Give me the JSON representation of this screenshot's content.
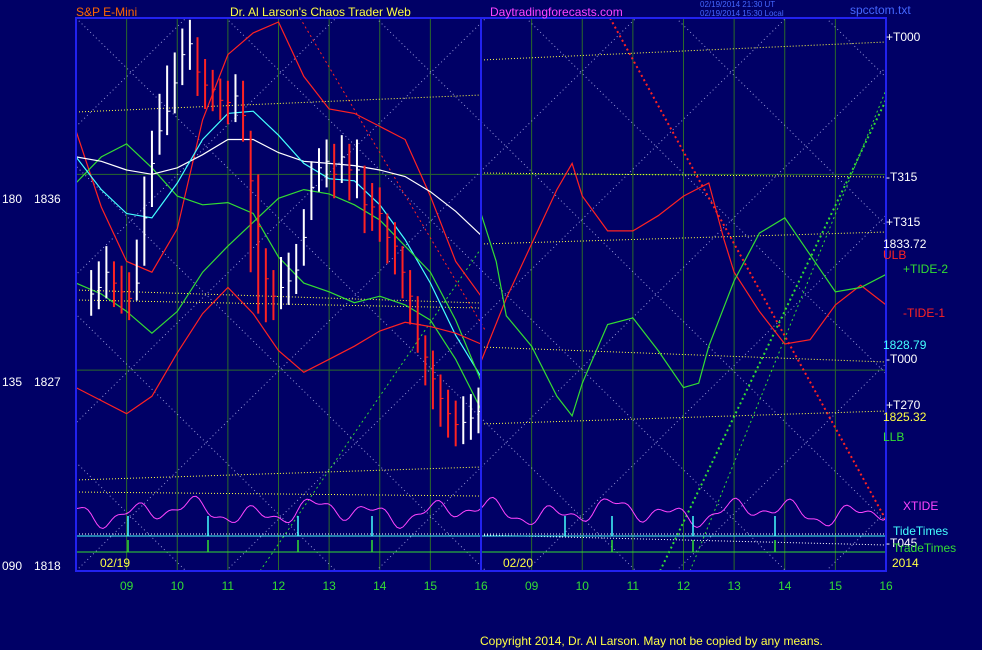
{
  "header": {
    "instrument": "S&P E-Mini",
    "site_title": "Dr. Al Larson's Chaos Trader Web",
    "site_url": "Daytradingforecasts.com",
    "timestamp_line1": "02/19/2014 21:30 UT",
    "timestamp_line2": "02/19/2014 15:30 Local",
    "file_name": "spcctom.txt"
  },
  "footer": {
    "copyright": "Copyright 2014, Dr. Al Larson. May not be copied by any means."
  },
  "colors": {
    "background": "#000066",
    "frame": "#2222ee",
    "grid": "#2a6a2a",
    "price_bar_up": "#ffffff",
    "price_bar_down": "#ff2222",
    "orange_text": "#ff6600",
    "magenta_text": "#ff44ff",
    "yellow_text": "#ffff44",
    "cyan": "#44ffff",
    "green": "#33dd33",
    "red": "#ff2222",
    "white": "#ffffff",
    "yellow": "#ffff44"
  },
  "chart_data": {
    "type": "line",
    "y_axis": {
      "left_labels": [
        {
          "price": 1836,
          "angle": "180"
        },
        {
          "price": 1827,
          "angle": "135"
        },
        {
          "price": 1818,
          "angle": "090"
        }
      ],
      "ylim": [
        1818,
        1843
      ]
    },
    "x_axis": {
      "day1_label": "02/19",
      "day2_label": "02/20",
      "year_label": "2014",
      "day1_hours": [
        "09",
        "10",
        "11",
        "12",
        "13",
        "14",
        "15",
        "16"
      ],
      "day2_hours": [
        "09",
        "10",
        "11",
        "12",
        "13",
        "14",
        "15",
        "16"
      ]
    },
    "price_levels": [
      {
        "label": "1833.72",
        "value": 1833.72
      },
      {
        "label": "1828.79",
        "value": 1828.79
      },
      {
        "label": "1825.32",
        "value": 1825.32
      }
    ],
    "right_labels": [
      {
        "text": "+T000",
        "color": "#ffffff"
      },
      {
        "text": "-T315",
        "color": "#ffffff"
      },
      {
        "text": "+T315",
        "color": "#ffffff"
      },
      {
        "text": "1833.72",
        "color": "#ffffff"
      },
      {
        "text": "ULB",
        "color": "#ff2222"
      },
      {
        "text": "+TIDE-2",
        "color": "#33dd33"
      },
      {
        "text": "-TIDE-1",
        "color": "#ff2222"
      },
      {
        "text": "1828.79",
        "color": "#44ffff"
      },
      {
        "text": "-T000",
        "color": "#ffffff"
      },
      {
        "text": "+T270",
        "color": "#ffffff"
      },
      {
        "text": "1825.32",
        "color": "#ffff44"
      },
      {
        "text": "LLB",
        "color": "#33dd33"
      },
      {
        "text": "XTIDE",
        "color": "#ff44ff"
      },
      {
        "text": "TideTimes",
        "color": "#44ffff"
      },
      {
        "text": "-T045",
        "color": "#ffffff"
      },
      {
        "text": "TradeTimes",
        "color": "#33dd33"
      }
    ],
    "series": [
      {
        "name": "S&P E-Mini",
        "kind": "bars",
        "day": 1,
        "t": [
          8.3,
          8.45,
          8.6,
          8.75,
          8.9,
          9.05,
          9.2,
          9.35,
          9.5,
          9.65,
          9.8,
          9.95,
          10.1,
          10.25,
          10.4,
          10.55,
          10.7,
          10.85,
          11.0,
          11.15,
          11.3,
          11.45,
          11.6,
          11.75,
          11.9,
          12.05,
          12.2,
          12.35,
          12.5,
          12.65,
          12.8,
          12.95,
          13.1,
          13.25,
          13.4,
          13.55,
          13.7,
          13.85,
          14.0,
          14.15,
          14.3,
          14.45,
          14.6,
          14.75,
          14.9,
          15.05,
          15.2,
          15.35,
          15.5,
          15.65,
          15.8,
          15.95
        ],
        "close": [
          1830.5,
          1830.8,
          1831.5,
          1831.0,
          1830.6,
          1830.3,
          1831.0,
          1834.0,
          1836.5,
          1838.0,
          1838.9,
          1840.2,
          1841.5,
          1842.0,
          1840.7,
          1840.1,
          1839.9,
          1839.4,
          1839.3,
          1839.6,
          1838.7,
          1835.7,
          1833.6,
          1831.2,
          1830.4,
          1830.8,
          1831.1,
          1831.6,
          1833.1,
          1835.4,
          1836.3,
          1836.6,
          1836.0,
          1836.8,
          1836.2,
          1836.2,
          1834.6,
          1834.5,
          1834.2,
          1833.1,
          1832.7,
          1831.5,
          1830.4,
          1829.1,
          1827.6,
          1826.6,
          1825.7,
          1825.0,
          1824.5,
          1824.6,
          1824.8,
          1825.1
        ],
        "high": [
          1831.6,
          1832.0,
          1832.7,
          1832.0,
          1831.8,
          1831.5,
          1833.0,
          1835.9,
          1838.0,
          1839.7,
          1841.0,
          1841.6,
          1842.7,
          1843.1,
          1842.3,
          1841.3,
          1840.8,
          1840.4,
          1840.3,
          1840.6,
          1840.3,
          1838.0,
          1836.0,
          1832.6,
          1831.6,
          1832.2,
          1832.4,
          1832.8,
          1834.4,
          1836.6,
          1837.2,
          1837.6,
          1837.4,
          1837.8,
          1837.4,
          1837.6,
          1836.4,
          1835.6,
          1835.4,
          1834.2,
          1833.8,
          1832.7,
          1831.6,
          1830.4,
          1828.6,
          1827.9,
          1826.8,
          1826.1,
          1825.6,
          1825.8,
          1825.9,
          1826.2
        ],
        "low": [
          1829.5,
          1829.8,
          1830.3,
          1829.9,
          1829.6,
          1829.3,
          1830.2,
          1831.8,
          1834.5,
          1836.9,
          1837.8,
          1838.8,
          1840.1,
          1840.8,
          1839.6,
          1839.0,
          1838.9,
          1838.5,
          1838.3,
          1838.4,
          1837.5,
          1831.5,
          1829.6,
          1829.2,
          1829.3,
          1829.8,
          1830.0,
          1830.5,
          1831.8,
          1833.9,
          1835.2,
          1835.4,
          1834.9,
          1835.6,
          1834.8,
          1834.9,
          1833.3,
          1833.4,
          1832.9,
          1831.9,
          1831.4,
          1830.3,
          1829.1,
          1827.8,
          1826.3,
          1825.2,
          1824.4,
          1823.9,
          1823.5,
          1823.6,
          1823.8,
          1824.1
        ]
      },
      {
        "name": "ULB",
        "color": "#ff2222",
        "day": 1,
        "t": [
          8.0,
          8.5,
          9.0,
          9.5,
          10.0,
          10.5,
          11.0,
          11.5,
          12.0,
          12.5,
          13.0,
          13.5,
          14.0,
          14.5,
          15.0,
          15.5,
          16.0
        ],
        "v": [
          1838.0,
          1834.5,
          1832.0,
          1831.5,
          1833.5,
          1838.5,
          1841.5,
          1842.5,
          1843.0,
          1840.5,
          1839.0,
          1838.8,
          1838.2,
          1837.6,
          1835.0,
          1832.0,
          1830.4
        ]
      },
      {
        "name": "LLB",
        "color": "#33dd33",
        "day": 1,
        "t": [
          8.0,
          8.5,
          9.0,
          9.5,
          10.0,
          10.5,
          11.0,
          11.5,
          12.0,
          12.5,
          13.0,
          13.5,
          14.0,
          14.5,
          15.0,
          15.5,
          16.0
        ],
        "v": [
          1835.6,
          1836.8,
          1837.4,
          1836.3,
          1835.0,
          1834.6,
          1834.7,
          1834.2,
          1832.2,
          1831.0,
          1830.6,
          1830.1,
          1830.4,
          1830.0,
          1829.3,
          1827.5,
          1825.2
        ]
      },
      {
        "name": "MA-white",
        "color": "#ffffff",
        "day": 1,
        "t": [
          8.0,
          8.5,
          9.0,
          9.5,
          10.0,
          10.5,
          11.0,
          11.5,
          12.0,
          12.5,
          13.0,
          13.5,
          14.0,
          14.5,
          15.0,
          15.5,
          16.0
        ],
        "v": [
          1836.8,
          1836.6,
          1836.2,
          1836.0,
          1836.3,
          1836.9,
          1837.6,
          1837.6,
          1837.0,
          1836.6,
          1836.5,
          1836.4,
          1836.2,
          1835.9,
          1835.2,
          1834.3,
          1833.2
        ]
      },
      {
        "name": "MA-cyan",
        "color": "#44ffff",
        "day": 1,
        "t": [
          8.0,
          8.5,
          9.0,
          9.5,
          10.0,
          10.5,
          11.0,
          11.5,
          12.0,
          12.5,
          13.0,
          13.5,
          14.0,
          14.5,
          15.0,
          15.5,
          16.0
        ],
        "v": [
          1836.8,
          1835.3,
          1834.2,
          1834.0,
          1835.6,
          1837.6,
          1838.8,
          1838.9,
          1837.8,
          1836.5,
          1835.8,
          1835.7,
          1834.6,
          1833.0,
          1831.0,
          1828.6,
          1826.7
        ]
      },
      {
        "name": "MA-green",
        "color": "#33dd33",
        "day": 1,
        "t": [
          8.0,
          8.5,
          9.0,
          9.5,
          10.0,
          10.5,
          11.0,
          11.5,
          12.0,
          12.5,
          13.0,
          13.5,
          14.0,
          14.5,
          15.0,
          15.5,
          16.0
        ],
        "v": [
          1831.0,
          1830.5,
          1829.7,
          1828.7,
          1829.7,
          1831.5,
          1832.7,
          1833.8,
          1834.9,
          1835.3,
          1835.1,
          1834.6,
          1833.9,
          1832.7,
          1831.5,
          1829.3,
          1826.5
        ]
      },
      {
        "name": "TIDE-1",
        "color": "#ff2222",
        "day": 1,
        "t": [
          8.0,
          8.5,
          9.0,
          9.5,
          10.0,
          10.5,
          11.0,
          11.5,
          12.0,
          12.5,
          13.0,
          13.5,
          14.0,
          14.5,
          15.0,
          15.5,
          16.0
        ],
        "v": [
          1826.2,
          1825.6,
          1825.0,
          1825.8,
          1827.8,
          1829.6,
          1830.8,
          1829.6,
          1827.9,
          1826.9,
          1827.5,
          1828.1,
          1828.8,
          1829.2,
          1829.0,
          1828.7,
          1828.2
        ]
      },
      {
        "name": "-TIDE-1",
        "color": "#ff2222",
        "day": 2,
        "t": [
          8.0,
          8.5,
          9.0,
          9.5,
          9.8,
          10.0,
          10.5,
          11.0,
          11.5,
          12.0,
          12.5,
          12.8,
          13.0,
          13.5,
          14.0,
          14.5,
          15.0,
          15.5,
          16.0
        ],
        "v": [
          1827.4,
          1830.3,
          1832.8,
          1835.3,
          1836.5,
          1835.0,
          1833.4,
          1833.4,
          1834.1,
          1835.0,
          1835.6,
          1833.0,
          1831.5,
          1829.7,
          1828.2,
          1828.4,
          1830.0,
          1830.9,
          1830.0
        ]
      },
      {
        "name": "+TIDE-2",
        "color": "#33dd33",
        "day": 2,
        "t": [
          8.0,
          8.3,
          8.5,
          9.0,
          9.5,
          9.8,
          10.0,
          10.5,
          11.0,
          11.5,
          12.0,
          12.3,
          12.5,
          13.0,
          13.5,
          14.0,
          14.5,
          15.0,
          15.5,
          16.0
        ],
        "v": [
          1834.2,
          1832.0,
          1829.5,
          1828.1,
          1825.8,
          1824.9,
          1826.4,
          1829.1,
          1829.4,
          1827.9,
          1826.2,
          1826.4,
          1828.1,
          1831.1,
          1833.3,
          1834.0,
          1832.3,
          1830.6,
          1830.8,
          1831.4
        ]
      }
    ],
    "indicators": [
      {
        "name": "XTIDE",
        "color": "#ff44ff"
      },
      {
        "name": "TideTimes",
        "color": "#44ffff"
      },
      {
        "name": "TradeTimes",
        "color": "#33dd33"
      }
    ]
  }
}
